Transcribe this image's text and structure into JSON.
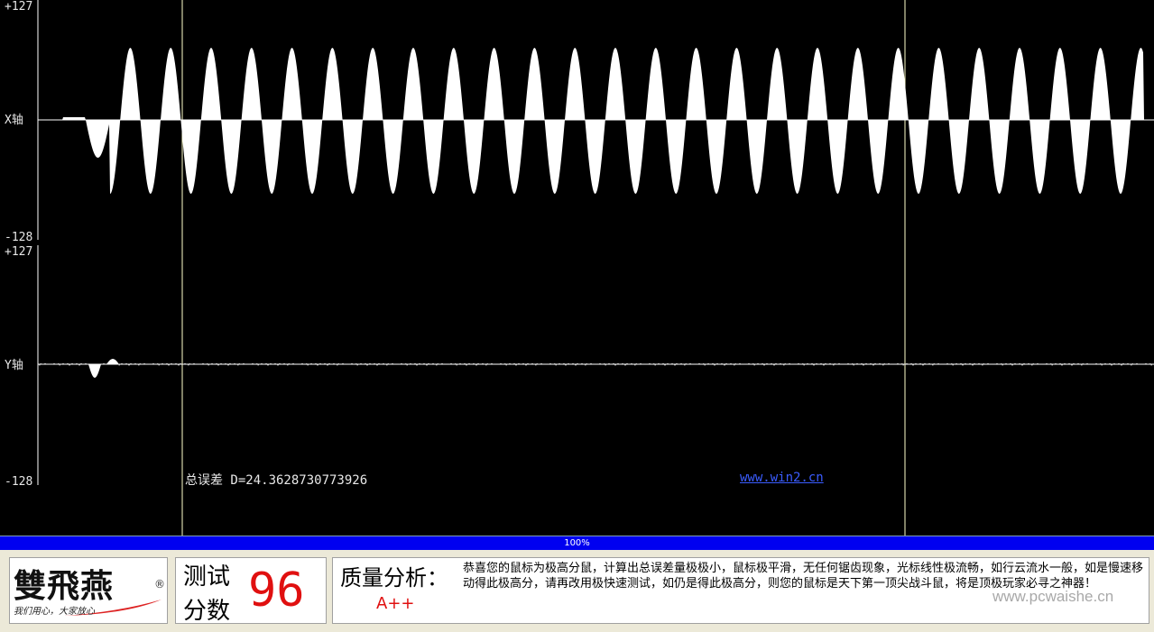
{
  "scope": {
    "x_axis": {
      "top_label": "+127",
      "bottom_label": "-128",
      "name": "X轴"
    },
    "y_axis": {
      "top_label": "+127",
      "bottom_label": "-128",
      "name": "Y轴"
    },
    "error_text": "总误差 D=24.3628730773926",
    "site_link": "www.win2.cn"
  },
  "progress": {
    "text": "100%",
    "value": 1.0
  },
  "logo": {
    "name": "雙飛燕",
    "registered": "®",
    "slogan": "我们用心，大家放心"
  },
  "score": {
    "label_1": "测试",
    "label_2": "分数",
    "value": "96"
  },
  "analysis": {
    "title": "质量分析：",
    "grade": "A++",
    "body": "恭喜您的鼠标为极高分鼠，计算出总误差量极极小，鼠标极平滑，无任何锯齿现象，光标线性极流畅，如行云流水一般，如是慢速移动得此极高分，请再改用极快速测试，如仍是得此极高分，则您的鼠标是天下第一顶尖战斗鼠，将是顶极玩家必寻之神器！"
  },
  "watermark": "www.pcwaishe.cn",
  "colors": {
    "scope_bg": "#000000",
    "trace": "#ffffff",
    "score": "#e01010",
    "progress": "#0000f0",
    "link": "#3a5cff"
  }
}
